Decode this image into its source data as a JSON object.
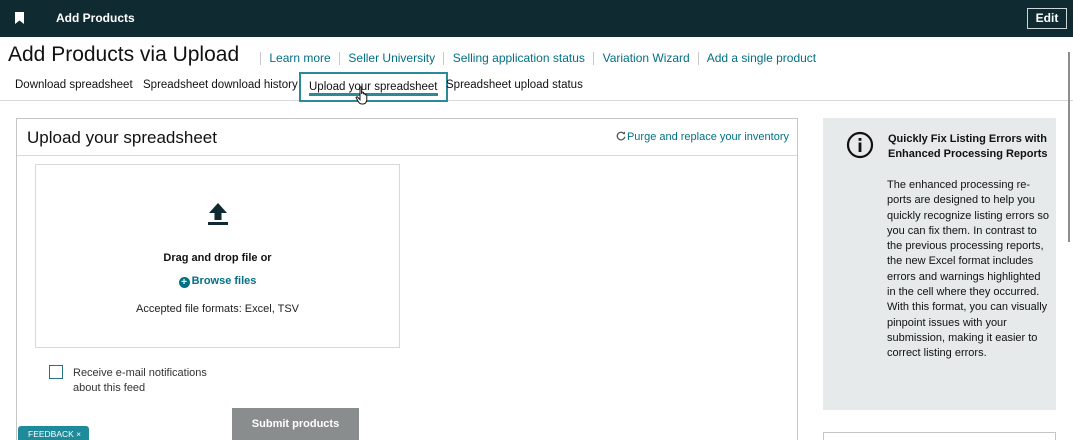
{
  "topbar": {
    "app_title": "Add Products",
    "edit_label": "Edit",
    "background": "#0f2a30"
  },
  "page": {
    "title": "Add Products via Upload",
    "quick_links": [
      "Learn more",
      "Seller University",
      "Selling application status",
      "Variation Wizard",
      "Add a single product"
    ]
  },
  "tabs": [
    {
      "label": "Download spreadsheet",
      "active": false
    },
    {
      "label": "Spreadsheet download history",
      "active": false
    },
    {
      "label": "Upload your spreadsheet",
      "active": true
    },
    {
      "label": "Spreadsheet upload status",
      "active": false
    }
  ],
  "upload": {
    "title": "Upload your spreadsheet",
    "purge_label": "Purge and replace your inventory",
    "drag_text": "Drag and drop file or",
    "browse_label": "Browse files",
    "formats_text": "Accepted file formats: Excel, TSV",
    "notify_label": "Receive e-mail notifications about this feed",
    "notify_checked": false,
    "submit_label": "Submit products"
  },
  "feedback": {
    "label": "FEEDBACK ×"
  },
  "info": {
    "heading": "Quickly Fix Listing Errors with Enhanced Processing Reports",
    "body": "The enhanced processing re-ports are designed to help you quickly recognize listing errors so you can fix them. In contrast to the previous processing reports, the new Excel format includes errors and warnings highlighted in the cell where they occurred. With this format, you can visually pinpoint issues with your submission, making it easier to correct listing errors."
  },
  "colors": {
    "link": "#007185",
    "accent": "#2a8a96",
    "submit_disabled": "#8a8d8e"
  },
  "icons": {
    "bookmark": "bookmark-icon",
    "upload": "upload-arrow-icon",
    "plus": "plus-circle-icon",
    "refresh": "refresh-icon",
    "info": "info-circle-icon",
    "cursor": "hand-pointer-icon"
  }
}
